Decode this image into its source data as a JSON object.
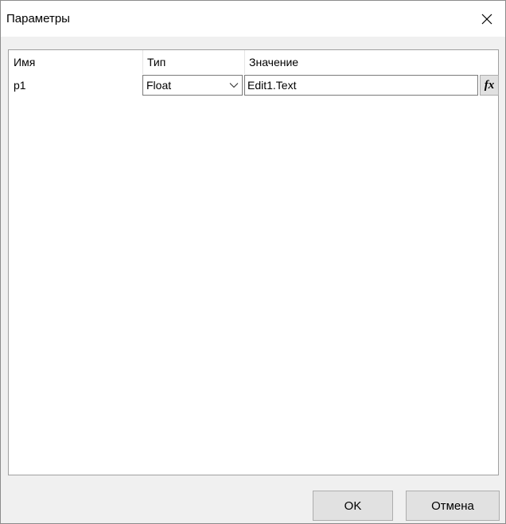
{
  "window": {
    "title": "Параметры",
    "close_icon": "close-icon"
  },
  "grid": {
    "columns": [
      "Имя",
      "Тип",
      "Значение"
    ],
    "rows": [
      {
        "name": "p1",
        "type": "Float",
        "value": "Edit1.Text",
        "fx_label": "fx"
      }
    ]
  },
  "buttons": {
    "ok": "OK",
    "cancel": "Отмена"
  }
}
